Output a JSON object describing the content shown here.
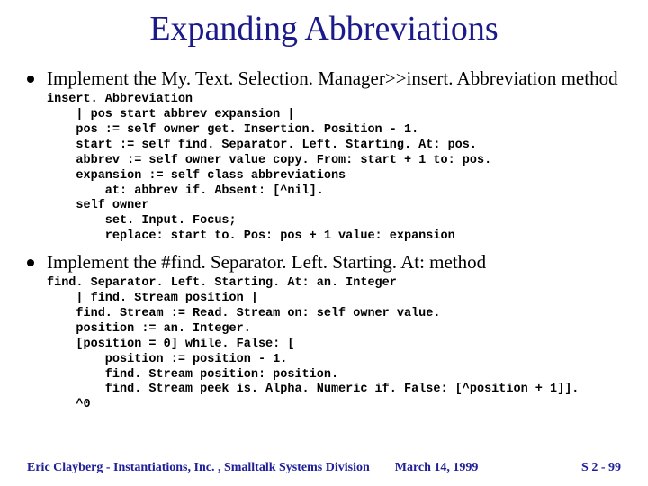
{
  "title": "Expanding Abbreviations",
  "bullets": [
    {
      "text": "Implement the My. Text. Selection. Manager>>insert. Abbreviation method",
      "code": "insert. Abbreviation\n    | pos start abbrev expansion |\n    pos := self owner get. Insertion. Position - 1.\n    start := self find. Separator. Left. Starting. At: pos.\n    abbrev := self owner value copy. From: start + 1 to: pos.\n    expansion := self class abbreviations\n        at: abbrev if. Absent: [^nil].\n    self owner\n        set. Input. Focus;\n        replace: start to. Pos: pos + 1 value: expansion"
    },
    {
      "text": "Implement the #find. Separator. Left. Starting. At: method",
      "code": "find. Separator. Left. Starting. At: an. Integer\n    | find. Stream position |\n    find. Stream := Read. Stream on: self owner value.\n    position := an. Integer.\n    [position = 0] while. False: [\n        position := position - 1.\n        find. Stream position: position.\n        find. Stream peek is. Alpha. Numeric if. False: [^position + 1]].\n    ^0"
    }
  ],
  "footer": {
    "author": "Eric Clayberg - Instantiations, Inc. , Smalltalk Systems Division",
    "date": "March 14, 1999",
    "page": "S 2 - 99"
  }
}
